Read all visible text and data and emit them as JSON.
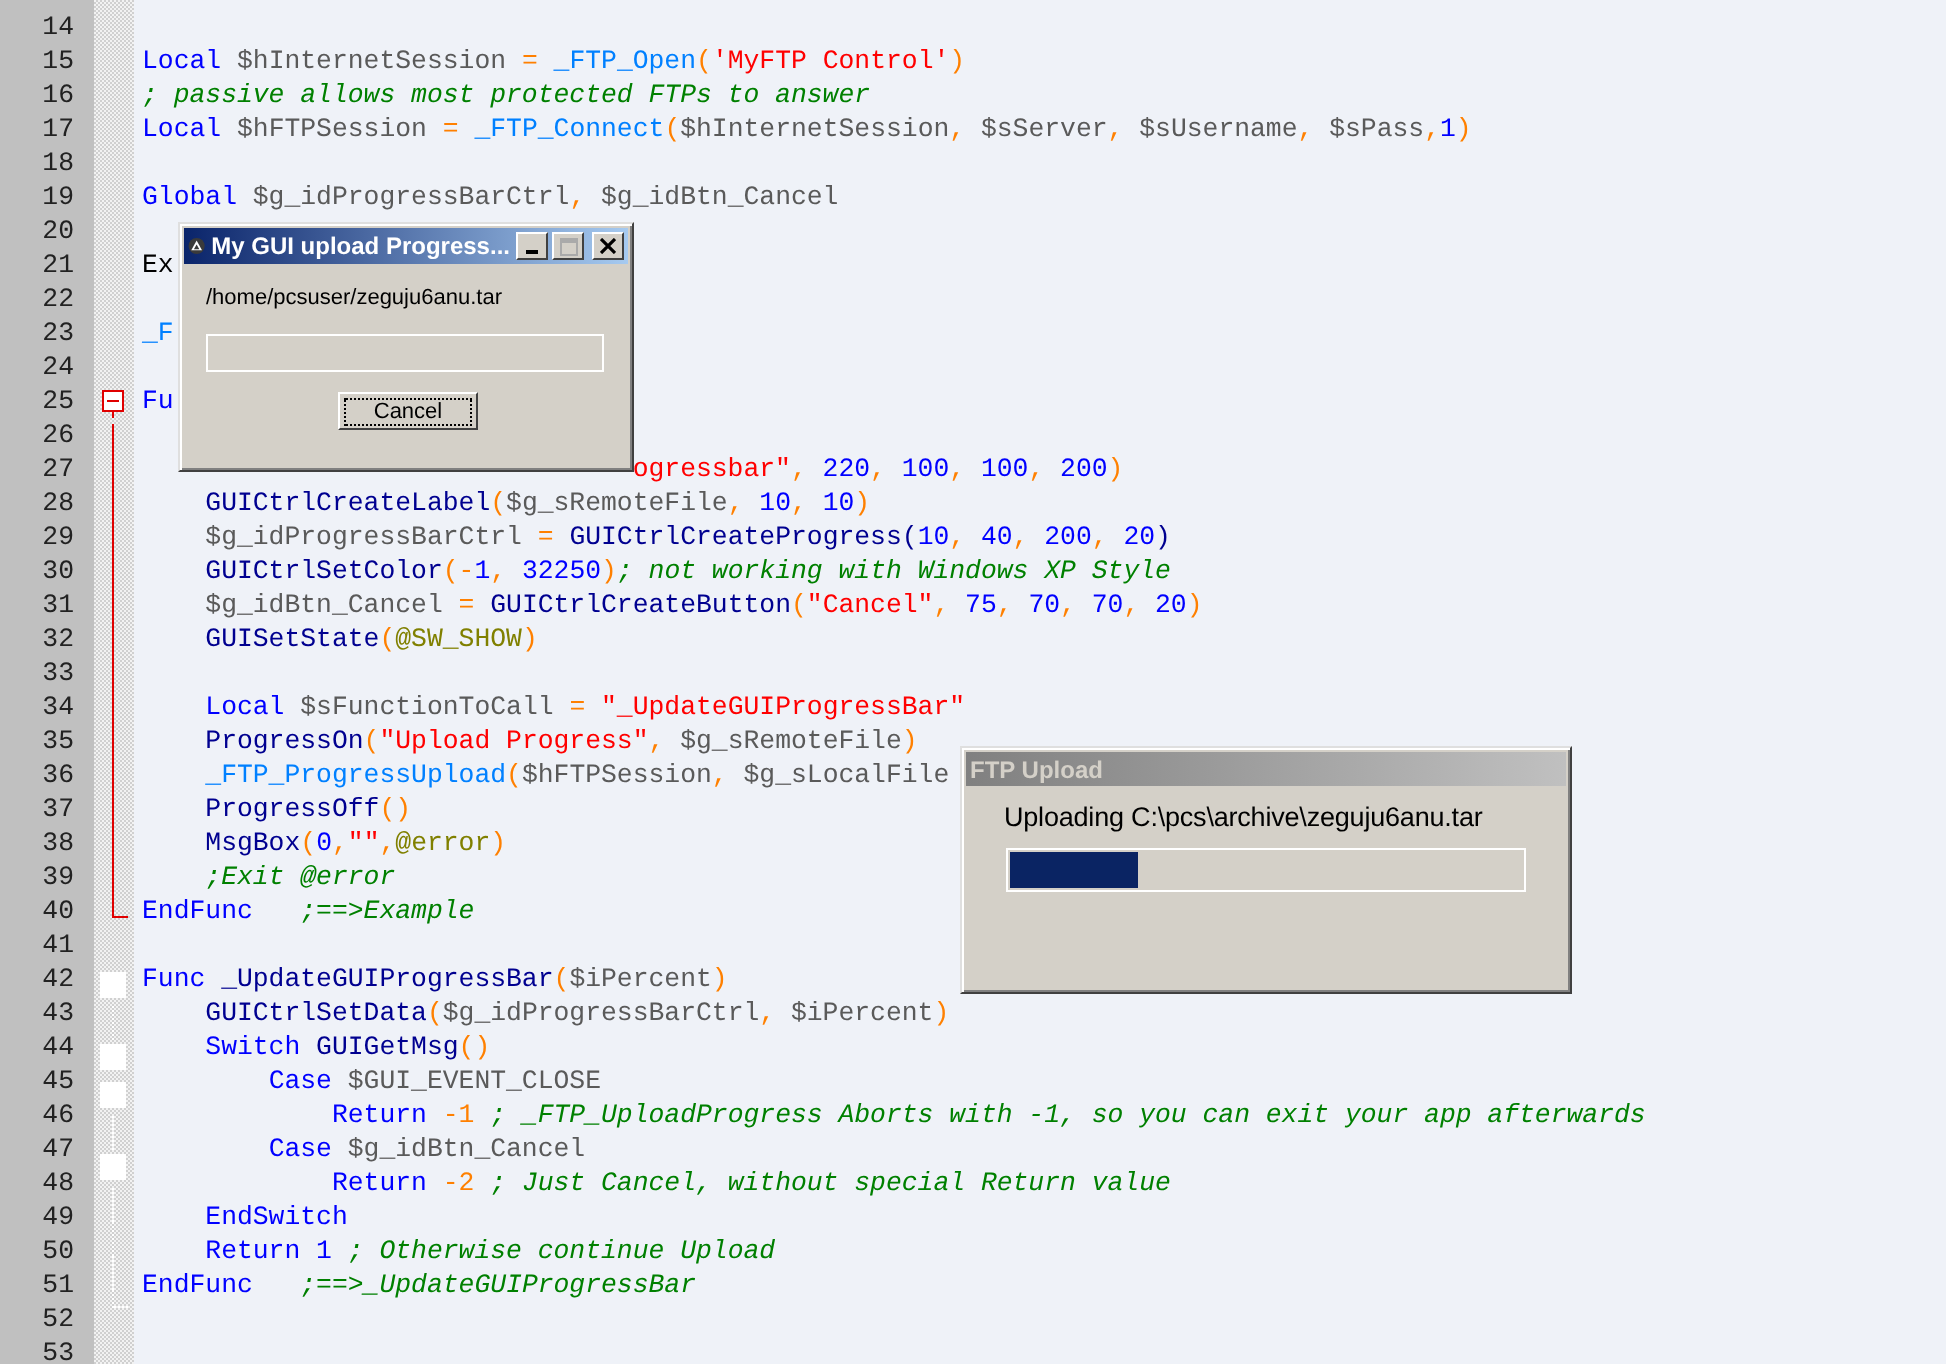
{
  "editor": {
    "lines": [
      {
        "number": "14"
      },
      {
        "number": "15",
        "tokens": [
          {
            "kind": "keyword",
            "text": "Local"
          },
          {
            "kind": "variable",
            "text": " $hInternetSession "
          },
          {
            "kind": "operator",
            "text": "="
          },
          {
            "kind": "udf",
            "text": " _FTP_Open"
          },
          {
            "kind": "operator",
            "text": "("
          },
          {
            "kind": "string",
            "text": "'MyFTP Control'"
          },
          {
            "kind": "operator",
            "text": ")"
          }
        ]
      },
      {
        "number": "16",
        "tokens": [
          {
            "kind": "comment",
            "text": "; passive allows most protected FTPs to answer"
          }
        ]
      },
      {
        "number": "17",
        "tokens": [
          {
            "kind": "keyword",
            "text": "Local"
          },
          {
            "kind": "variable",
            "text": " $hFTPSession "
          },
          {
            "kind": "operator",
            "text": "="
          },
          {
            "kind": "udf",
            "text": " _FTP_Connect"
          },
          {
            "kind": "operator",
            "text": "("
          },
          {
            "kind": "variable",
            "text": "$hInternetSession"
          },
          {
            "kind": "operator",
            "text": ", "
          },
          {
            "kind": "variable",
            "text": "$sServer"
          },
          {
            "kind": "operator",
            "text": ", "
          },
          {
            "kind": "variable",
            "text": "$sUsername"
          },
          {
            "kind": "operator",
            "text": ", "
          },
          {
            "kind": "variable",
            "text": "$sPass"
          },
          {
            "kind": "operator",
            "text": ","
          },
          {
            "kind": "number",
            "text": "1"
          },
          {
            "kind": "operator",
            "text": ")"
          }
        ]
      },
      {
        "number": "18"
      },
      {
        "number": "19",
        "tokens": [
          {
            "kind": "keyword",
            "text": "Global"
          },
          {
            "kind": "variable",
            "text": " $g_idProgressBarCtrl"
          },
          {
            "kind": "operator",
            "text": ", "
          },
          {
            "kind": "variable",
            "text": "$g_idBtn_Cancel"
          }
        ]
      },
      {
        "number": "20"
      },
      {
        "number": "21",
        "tokens": [
          {
            "kind": "plain",
            "text": "Ex"
          }
        ]
      },
      {
        "number": "22"
      },
      {
        "number": "23",
        "tokens": [
          {
            "kind": "udf",
            "text": "_F"
          }
        ]
      },
      {
        "number": "24"
      },
      {
        "number": "25",
        "kind": "head-red",
        "tokens": [
          {
            "kind": "keyword",
            "text": "Fu"
          }
        ]
      },
      {
        "number": "26",
        "kind": "line-red"
      },
      {
        "number": "27",
        "kind": "line-red",
        "tokens": [
          {
            "kind": "string",
            "text": "                               ogressbar\""
          },
          {
            "kind": "operator",
            "text": ", "
          },
          {
            "kind": "number",
            "text": "220"
          },
          {
            "kind": "operator",
            "text": ", "
          },
          {
            "kind": "number",
            "text": "100"
          },
          {
            "kind": "operator",
            "text": ", "
          },
          {
            "kind": "number",
            "text": "100"
          },
          {
            "kind": "operator",
            "text": ", "
          },
          {
            "kind": "number",
            "text": "200"
          },
          {
            "kind": "operator",
            "text": ")"
          }
        ]
      },
      {
        "number": "28",
        "kind": "line-red",
        "tokens": [
          {
            "kind": "function",
            "text": "    GUICtrlCreateLabel"
          },
          {
            "kind": "operator",
            "text": "("
          },
          {
            "kind": "variable",
            "text": "$g_sRemoteFile"
          },
          {
            "kind": "operator",
            "text": ", "
          },
          {
            "kind": "number",
            "text": "10"
          },
          {
            "kind": "operator",
            "text": ", "
          },
          {
            "kind": "number",
            "text": "10"
          },
          {
            "kind": "operator",
            "text": ")"
          }
        ]
      },
      {
        "number": "29",
        "kind": "line-red",
        "tokens": [
          {
            "kind": "variable",
            "text": "    $g_idProgressBarCtrl "
          },
          {
            "kind": "operator",
            "text": "="
          },
          {
            "kind": "function",
            "text": " GUICtrlCreateProgress("
          },
          {
            "kind": "number",
            "text": "10"
          },
          {
            "kind": "operator",
            "text": ", "
          },
          {
            "kind": "number",
            "text": "40"
          },
          {
            "kind": "operator",
            "text": ", "
          },
          {
            "kind": "number",
            "text": "200"
          },
          {
            "kind": "operator",
            "text": ", "
          },
          {
            "kind": "number",
            "text": "20"
          },
          {
            "kind": "function",
            "text": ")"
          }
        ]
      },
      {
        "number": "30",
        "kind": "line-red",
        "tokens": [
          {
            "kind": "function",
            "text": "    GUICtrlSetColor"
          },
          {
            "kind": "operator",
            "text": "(-"
          },
          {
            "kind": "number",
            "text": "1"
          },
          {
            "kind": "operator",
            "text": ", "
          },
          {
            "kind": "number",
            "text": "32250"
          },
          {
            "kind": "operator",
            "text": ")"
          },
          {
            "kind": "comment",
            "text": "; not working with Windows XP Style"
          }
        ]
      },
      {
        "number": "31",
        "kind": "line-red",
        "tokens": [
          {
            "kind": "variable",
            "text": "    $g_idBtn_Cancel "
          },
          {
            "kind": "operator",
            "text": "="
          },
          {
            "kind": "function",
            "text": " GUICtrlCreateButton"
          },
          {
            "kind": "operator",
            "text": "("
          },
          {
            "kind": "string",
            "text": "\"Cancel\""
          },
          {
            "kind": "operator",
            "text": ", "
          },
          {
            "kind": "number",
            "text": "75"
          },
          {
            "kind": "operator",
            "text": ", "
          },
          {
            "kind": "number",
            "text": "70"
          },
          {
            "kind": "operator",
            "text": ", "
          },
          {
            "kind": "number",
            "text": "70"
          },
          {
            "kind": "operator",
            "text": ", "
          },
          {
            "kind": "number",
            "text": "20"
          },
          {
            "kind": "operator",
            "text": ")"
          }
        ]
      },
      {
        "number": "32",
        "kind": "line-red",
        "tokens": [
          {
            "kind": "function",
            "text": "    GUISetState"
          },
          {
            "kind": "operator",
            "text": "("
          },
          {
            "kind": "macro",
            "text": "@SW_SHOW"
          },
          {
            "kind": "operator",
            "text": ")"
          }
        ]
      },
      {
        "number": "33",
        "kind": "line-red"
      },
      {
        "number": "34",
        "kind": "line-red",
        "tokens": [
          {
            "kind": "keyword",
            "text": "    Local"
          },
          {
            "kind": "variable",
            "text": " $sFunctionToCall "
          },
          {
            "kind": "operator",
            "text": "="
          },
          {
            "kind": "string",
            "text": " \"_UpdateGUIProgressBar\""
          }
        ]
      },
      {
        "number": "35",
        "kind": "line-red",
        "tokens": [
          {
            "kind": "function",
            "text": "    ProgressOn"
          },
          {
            "kind": "operator",
            "text": "("
          },
          {
            "kind": "string",
            "text": "\"Upload Progress\""
          },
          {
            "kind": "operator",
            "text": ", "
          },
          {
            "kind": "variable",
            "text": "$g_sRemoteFile"
          },
          {
            "kind": "operator",
            "text": ")"
          }
        ]
      },
      {
        "number": "36",
        "kind": "line-red",
        "tokens": [
          {
            "kind": "udf",
            "text": "    _FTP_ProgressUpload"
          },
          {
            "kind": "operator",
            "text": "("
          },
          {
            "kind": "variable",
            "text": "$hFTPSession"
          },
          {
            "kind": "operator",
            "text": ", "
          },
          {
            "kind": "variable",
            "text": "$g_sLocalFile"
          }
        ]
      },
      {
        "number": "37",
        "kind": "line-red",
        "tokens": [
          {
            "kind": "function",
            "text": "    ProgressOff"
          },
          {
            "kind": "operator",
            "text": "()"
          }
        ]
      },
      {
        "number": "38",
        "kind": "line-red",
        "tokens": [
          {
            "kind": "function",
            "text": "    MsgBox"
          },
          {
            "kind": "operator",
            "text": "("
          },
          {
            "kind": "number",
            "text": "0"
          },
          {
            "kind": "operator",
            "text": ","
          },
          {
            "kind": "string",
            "text": "\"\""
          },
          {
            "kind": "operator",
            "text": ","
          },
          {
            "kind": "macro",
            "text": "@error"
          },
          {
            "kind": "operator",
            "text": ")"
          }
        ]
      },
      {
        "number": "39",
        "kind": "line-red",
        "tokens": [
          {
            "kind": "comment",
            "text": "    ;Exit @error"
          }
        ]
      },
      {
        "number": "40",
        "kind": "end-red",
        "tokens": [
          {
            "kind": "keyword",
            "text": "EndFunc"
          },
          {
            "kind": "comment",
            "text": "   ;==>Example"
          }
        ]
      },
      {
        "number": "41"
      },
      {
        "number": "42",
        "kind": "head",
        "tokens": [
          {
            "kind": "keyword",
            "text": "Func"
          },
          {
            "kind": "function",
            "text": " _UpdateGUIProgressBar"
          },
          {
            "kind": "operator",
            "text": "("
          },
          {
            "kind": "variable",
            "text": "$iPercent"
          },
          {
            "kind": "operator",
            "text": ")"
          }
        ]
      },
      {
        "number": "43",
        "kind": "line",
        "tokens": [
          {
            "kind": "function",
            "text": "    GUICtrlSetData"
          },
          {
            "kind": "operator",
            "text": "("
          },
          {
            "kind": "variable",
            "text": "$g_idProgressBarCtrl"
          },
          {
            "kind": "operator",
            "text": ", "
          },
          {
            "kind": "variable",
            "text": "$iPercent"
          },
          {
            "kind": "operator",
            "text": ")"
          }
        ]
      },
      {
        "number": "44",
        "kind": "head",
        "tokens": [
          {
            "kind": "keyword",
            "text": "    Switch"
          },
          {
            "kind": "function",
            "text": " GUIGetMsg"
          },
          {
            "kind": "operator",
            "text": "()"
          }
        ]
      },
      {
        "number": "45",
        "kind": "head",
        "tokens": [
          {
            "kind": "keyword",
            "text": "        Case"
          },
          {
            "kind": "variable",
            "text": " $GUI_EVENT_CLOSE"
          }
        ]
      },
      {
        "number": "46",
        "kind": "line",
        "tokens": [
          {
            "kind": "keyword",
            "text": "            Return"
          },
          {
            "kind": "operator",
            "text": " -1"
          },
          {
            "kind": "comment",
            "text": " ; _FTP_UploadProgress Aborts with -1, so you can exit your app afterwards"
          }
        ]
      },
      {
        "number": "47",
        "kind": "head",
        "tokens": [
          {
            "kind": "keyword",
            "text": "        Case"
          },
          {
            "kind": "variable",
            "text": " $g_idBtn_Cancel"
          }
        ]
      },
      {
        "number": "48",
        "kind": "line",
        "tokens": [
          {
            "kind": "keyword",
            "text": "            Return"
          },
          {
            "kind": "operator",
            "text": " -2"
          },
          {
            "kind": "comment",
            "text": " ; Just Cancel, without special Return value"
          }
        ]
      },
      {
        "number": "49",
        "kind": "line",
        "tokens": [
          {
            "kind": "keyword",
            "text": "    EndSwitch"
          }
        ]
      },
      {
        "number": "50",
        "kind": "line",
        "tokens": [
          {
            "kind": "keyword",
            "text": "    Return"
          },
          {
            "kind": "number",
            "text": " 1"
          },
          {
            "kind": "comment",
            "text": " ; Otherwise continue Upload"
          }
        ]
      },
      {
        "number": "51",
        "kind": "end",
        "tokens": [
          {
            "kind": "keyword",
            "text": "EndFunc"
          },
          {
            "kind": "comment",
            "text": "   ;==>_UpdateGUIProgressBar"
          }
        ]
      },
      {
        "number": "52"
      },
      {
        "number": "53"
      }
    ]
  },
  "dialogs": [
    {
      "title": "My GUI upload Progress...",
      "active": true,
      "caption_buttons": true,
      "label": "/home/pcsuser/zeguju6anu.tar",
      "empty_progress_track": true,
      "button": "Cancel"
    },
    {
      "title": "FTP Upload",
      "active": false,
      "caption_buttons": false,
      "label": "Uploading C:\\pcs\\archive\\zeguju6anu.tar",
      "progress": {
        "level": 0.25
      }
    }
  ]
}
